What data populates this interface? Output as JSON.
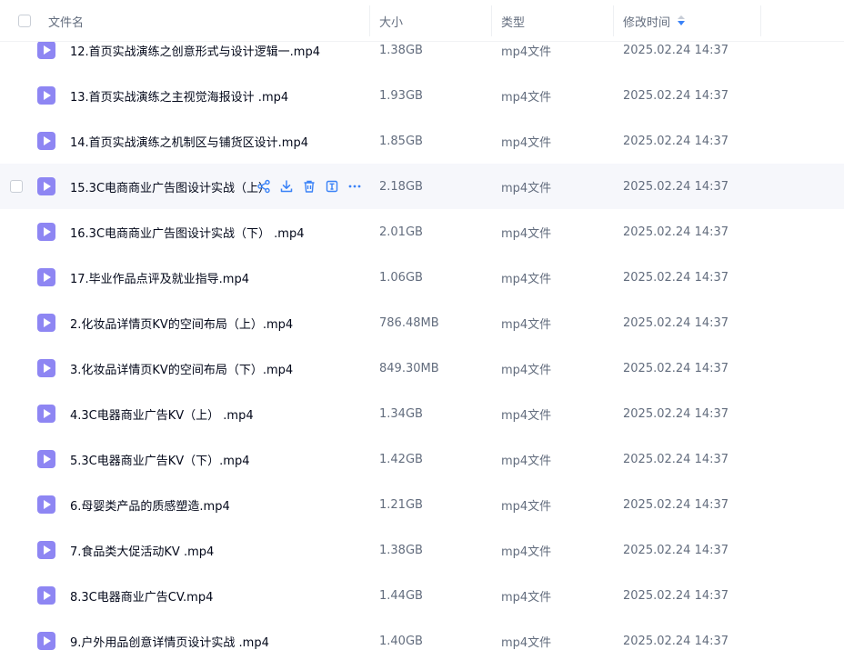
{
  "header": {
    "name_label": "文件名",
    "size_label": "大小",
    "type_label": "类型",
    "time_label": "修改时间"
  },
  "colors": {
    "accent": "#3a82f7",
    "file_icon": "#8e86f3",
    "hover_row": "#f6f7fb"
  },
  "files": [
    {
      "name": "12.首页实战演练之创意形式与设计逻辑一.mp4",
      "size": "1.38GB",
      "type": "mp4文件",
      "time": "2025.02.24 14:37"
    },
    {
      "name": "13.首页实战演练之主视觉海报设计 .mp4",
      "size": "1.93GB",
      "type": "mp4文件",
      "time": "2025.02.24 14:37"
    },
    {
      "name": "14.首页实战演练之机制区与铺货区设计.mp4",
      "size": "1.85GB",
      "type": "mp4文件",
      "time": "2025.02.24 14:37"
    },
    {
      "name": "15.3C电商商业广告图设计实战（上）",
      "size": "2.18GB",
      "type": "mp4文件",
      "time": "2025.02.24 14:37",
      "hovered": true
    },
    {
      "name": "16.3C电商商业广告图设计实战（下） .mp4",
      "size": "2.01GB",
      "type": "mp4文件",
      "time": "2025.02.24 14:37"
    },
    {
      "name": "17.毕业作品点评及就业指导.mp4",
      "size": "1.06GB",
      "type": "mp4文件",
      "time": "2025.02.24 14:37"
    },
    {
      "name": "2.化妆品详情页KV的空间布局（上）.mp4",
      "size": "786.48MB",
      "type": "mp4文件",
      "time": "2025.02.24 14:37"
    },
    {
      "name": "3.化妆品详情页KV的空间布局（下）.mp4",
      "size": "849.30MB",
      "type": "mp4文件",
      "time": "2025.02.24 14:37"
    },
    {
      "name": "4.3C电器商业广告KV（上） .mp4",
      "size": "1.34GB",
      "type": "mp4文件",
      "time": "2025.02.24 14:37"
    },
    {
      "name": "5.3C电器商业广告KV（下）.mp4",
      "size": "1.42GB",
      "type": "mp4文件",
      "time": "2025.02.24 14:37"
    },
    {
      "name": "6.母婴类产品的质感塑造.mp4",
      "size": "1.21GB",
      "type": "mp4文件",
      "time": "2025.02.24 14:37"
    },
    {
      "name": "7.食品类大促活动KV .mp4",
      "size": "1.38GB",
      "type": "mp4文件",
      "time": "2025.02.24 14:37"
    },
    {
      "name": "8.3C电器商业广告CV.mp4",
      "size": "1.44GB",
      "type": "mp4文件",
      "time": "2025.02.24 14:37"
    },
    {
      "name": "9.户外用品创意详情页设计实战 .mp4",
      "size": "1.40GB",
      "type": "mp4文件",
      "time": "2025.02.24 14:37"
    }
  ]
}
